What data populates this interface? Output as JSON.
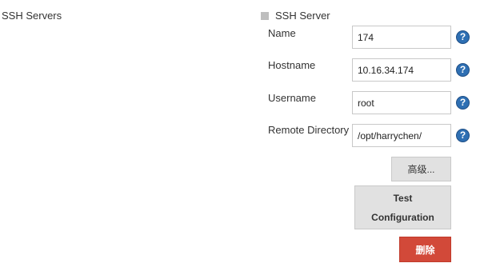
{
  "section": {
    "label": "SSH Servers"
  },
  "server": {
    "title": "SSH Server",
    "fields": [
      {
        "label": "Name",
        "value": "174"
      },
      {
        "label": "Hostname",
        "value": "10.16.34.174"
      },
      {
        "label": "Username",
        "value": "root"
      },
      {
        "label": "Remote Directory",
        "value": "/opt/harrychen/"
      }
    ],
    "help_glyph": "?",
    "buttons": {
      "advanced": "高级...",
      "test_line1": "Test",
      "test_line2": "Configuration",
      "delete": "删除"
    }
  },
  "colors": {
    "delete_button": "#d24939",
    "help_icon": "#2e6fb3",
    "neutral_button": "#e1e1e1"
  },
  "icons": {
    "drag_handle": "drag-handle-icon",
    "help": "help-icon"
  }
}
